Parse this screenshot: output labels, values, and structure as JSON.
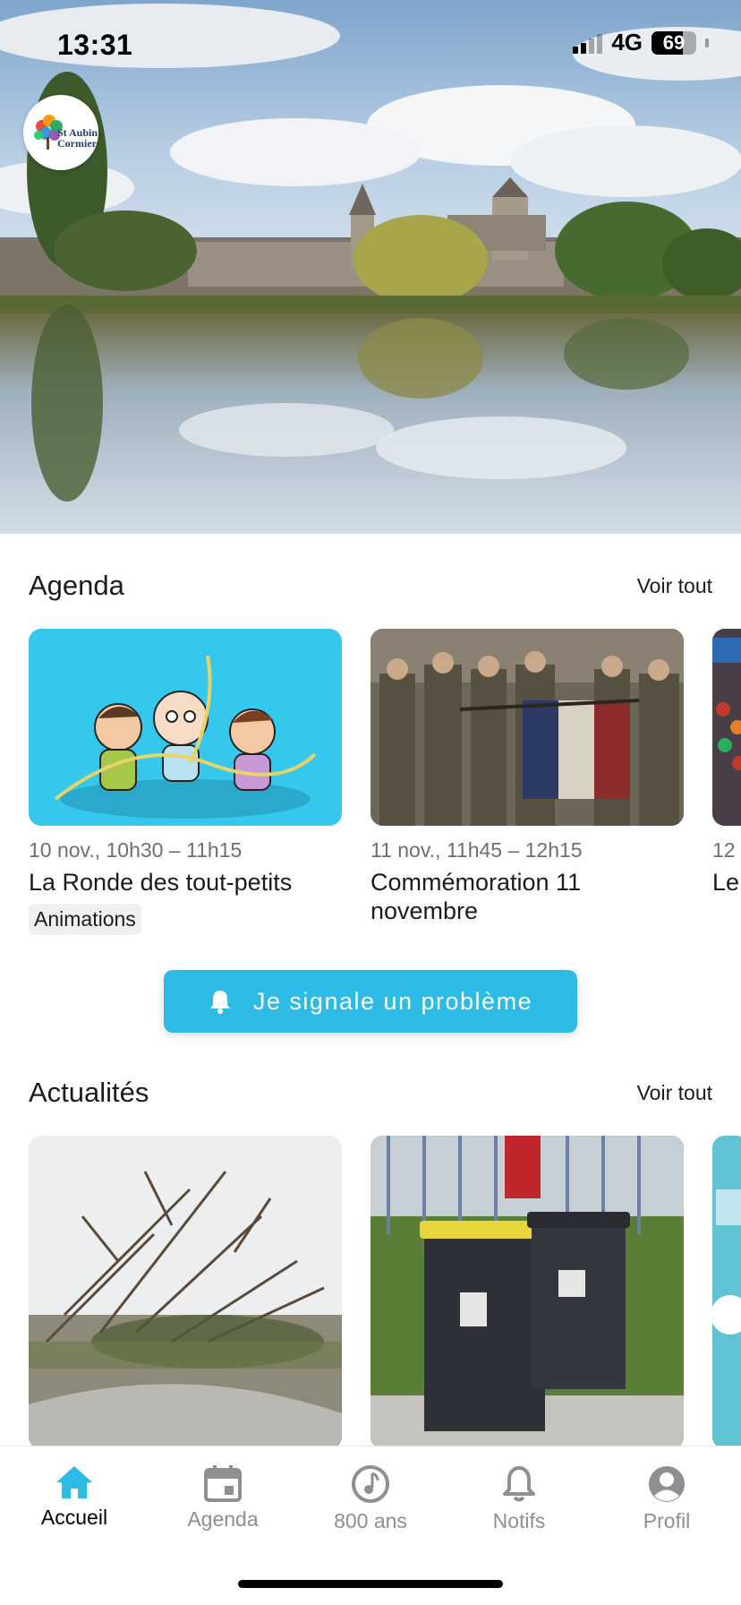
{
  "status_bar": {
    "time": "13:31",
    "network": "4G",
    "battery": "69",
    "battery_level": 0.69
  },
  "logo": {
    "alt": "Saint-Aubin-du-Cormier",
    "text_line1": "St Aubin",
    "text_line2": "Cormier"
  },
  "agenda": {
    "title": "Agenda",
    "see_all": "Voir tout",
    "events": [
      {
        "date": "10 nov., 10h30 – 11h15",
        "title": "La Ronde des tout-petits",
        "tag": "Animations"
      },
      {
        "date": "11 nov., 11h45 – 12h15",
        "title": "Commémoration 11 novembre",
        "tag": ""
      },
      {
        "date": "12",
        "title": "Le",
        "tag": ""
      }
    ]
  },
  "report_button": {
    "label": "Je signale un problème",
    "icon": "bell-icon"
  },
  "news": {
    "title": "Actualités",
    "see_all": "Voir tout"
  },
  "tab_bar": {
    "active": "home",
    "tabs": [
      {
        "id": "home",
        "label": "Accueil",
        "icon": "home-icon"
      },
      {
        "id": "agenda",
        "label": "Agenda",
        "icon": "calendar-icon"
      },
      {
        "id": "800",
        "label": "800 ans",
        "icon": "music-note-icon"
      },
      {
        "id": "notifs",
        "label": "Notifs",
        "icon": "bell-icon"
      },
      {
        "id": "profile",
        "label": "Profil",
        "icon": "user-icon"
      }
    ]
  },
  "colors": {
    "accent": "#2dbbe6",
    "active_tab_icon": "#2dbbe6",
    "inactive_tab": "#8e8e93"
  }
}
